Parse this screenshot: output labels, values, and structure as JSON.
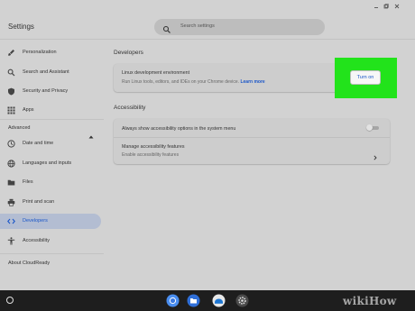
{
  "window": {
    "title": "Settings",
    "search_placeholder": "Search settings"
  },
  "sidebar": {
    "items": [
      {
        "label": "Personalization",
        "icon": "brush-icon"
      },
      {
        "label": "Search and Assistant",
        "icon": "search-icon"
      },
      {
        "label": "Security and Privacy",
        "icon": "shield-icon"
      },
      {
        "label": "Apps",
        "icon": "grid-icon"
      }
    ],
    "advanced_label": "Advanced",
    "advanced_items": [
      {
        "label": "Date and time",
        "icon": "clock-icon"
      },
      {
        "label": "Languages and inputs",
        "icon": "globe-icon"
      },
      {
        "label": "Files",
        "icon": "folder-icon"
      },
      {
        "label": "Print and scan",
        "icon": "printer-icon"
      },
      {
        "label": "Developers",
        "icon": "code-icon",
        "active": true
      },
      {
        "label": "Accessibility",
        "icon": "accessibility-icon"
      }
    ],
    "about_label": "About CloudReady"
  },
  "main": {
    "developers": {
      "heading": "Developers",
      "linux_title": "Linux development environment",
      "linux_sub": "Run Linux tools, editors, and IDEs on your Chrome device.",
      "learn_more": "Learn more",
      "turn_on_label": "Turn on"
    },
    "accessibility": {
      "heading": "Accessibility",
      "always_show": "Always show accessibility options in the system menu",
      "always_show_enabled": false,
      "manage_title": "Manage accessibility features",
      "manage_sub": "Enable accessibility features"
    }
  },
  "watermark": "wikiHow",
  "colors": {
    "accent": "#1a56c8",
    "highlight": "#22e31b",
    "shelf": "#1e1e1e"
  }
}
